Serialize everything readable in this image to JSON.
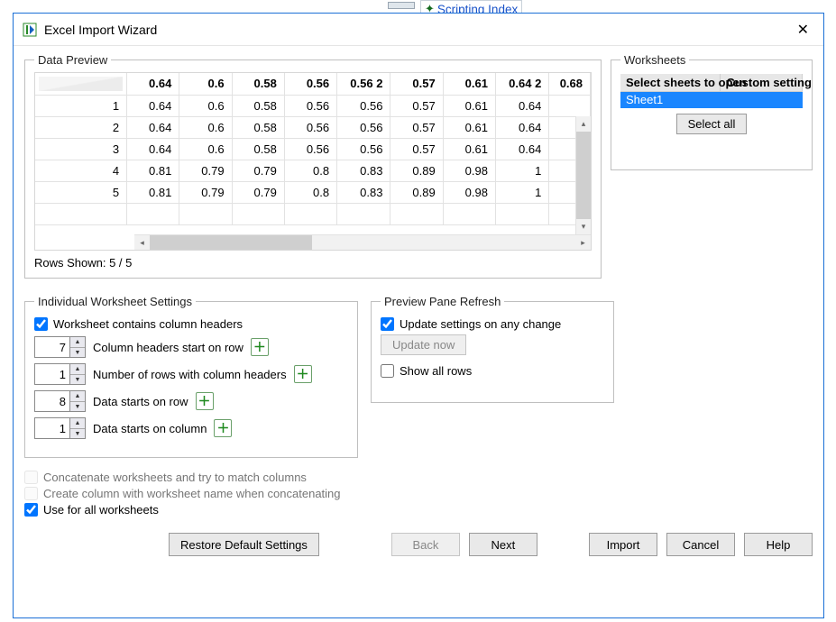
{
  "header_hint": {
    "label": "Scripting Index"
  },
  "window": {
    "title": "Excel Import Wizard"
  },
  "preview": {
    "legend": "Data Preview",
    "columns": [
      "0.64",
      "0.6",
      "0.58",
      "0.56",
      "0.56 2",
      "0.57",
      "0.61",
      "0.64 2",
      "0.68"
    ],
    "rows": [
      {
        "idx": "1",
        "cells": [
          "0.64",
          "0.6",
          "0.58",
          "0.56",
          "0.56",
          "0.57",
          "0.61",
          "0.64"
        ]
      },
      {
        "idx": "2",
        "cells": [
          "0.64",
          "0.6",
          "0.58",
          "0.56",
          "0.56",
          "0.57",
          "0.61",
          "0.64"
        ]
      },
      {
        "idx": "3",
        "cells": [
          "0.64",
          "0.6",
          "0.58",
          "0.56",
          "0.56",
          "0.57",
          "0.61",
          "0.64"
        ]
      },
      {
        "idx": "4",
        "cells": [
          "0.81",
          "0.79",
          "0.79",
          "0.8",
          "0.83",
          "0.89",
          "0.98",
          "1"
        ]
      },
      {
        "idx": "5",
        "cells": [
          "0.81",
          "0.79",
          "0.79",
          "0.8",
          "0.83",
          "0.89",
          "0.98",
          "1"
        ]
      }
    ],
    "rows_shown": "Rows Shown: 5 / 5"
  },
  "worksheets": {
    "legend": "Worksheets",
    "col1": "Select sheets to open",
    "col2": "Custom setting",
    "rows": [
      {
        "name": "Sheet1",
        "custom": ""
      }
    ],
    "select_all": "Select all"
  },
  "iws": {
    "legend": "Individual Worksheet Settings",
    "contains_headers": {
      "label": "Worksheet contains column headers",
      "checked": true
    },
    "header_row": {
      "value": "7",
      "label": "Column headers start on row"
    },
    "header_count": {
      "value": "1",
      "label": "Number of rows with column headers"
    },
    "data_row": {
      "value": "8",
      "label": "Data starts on row"
    },
    "data_col": {
      "value": "1",
      "label": "Data starts on column"
    }
  },
  "ppr": {
    "legend": "Preview Pane Refresh",
    "auto": {
      "label": "Update settings on any change",
      "checked": true
    },
    "update_now": "Update now",
    "show_all": {
      "label": "Show all rows",
      "checked": false
    }
  },
  "lower": {
    "concat": {
      "label": "Concatenate worksheets and try to match columns",
      "checked": false,
      "enabled": false
    },
    "create_ws": {
      "label": "Create column with worksheet name when concatenating",
      "checked": false,
      "enabled": false
    },
    "use_all": {
      "label": "Use for all worksheets",
      "checked": true
    }
  },
  "buttons": {
    "restore": "Restore Default Settings",
    "back": "Back",
    "next": "Next",
    "import": "Import",
    "cancel": "Cancel",
    "help": "Help"
  }
}
